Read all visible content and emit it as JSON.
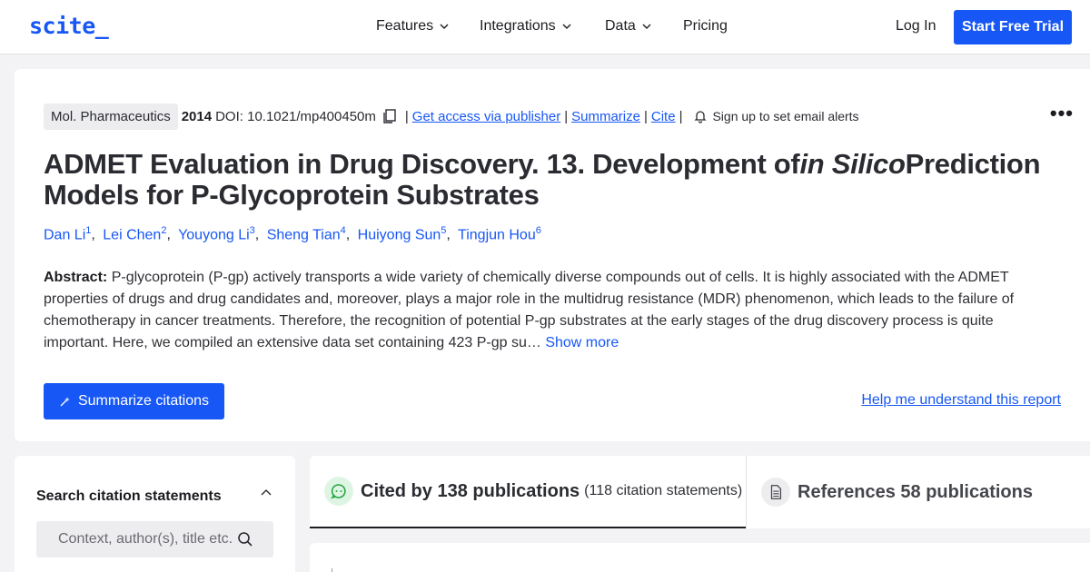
{
  "nav": {
    "logo": "scite_",
    "items": [
      "Features",
      "Integrations",
      "Data",
      "Pricing"
    ],
    "login": "Log In",
    "trial": "Start Free Trial"
  },
  "paper": {
    "journal": "Mol. Pharmaceutics",
    "year": "2014",
    "doi": "DOI: 10.1021/mp400450m",
    "links": {
      "access": "Get access via publisher",
      "summarize": "Summarize",
      "cite": "Cite"
    },
    "alert": "Sign up to set email alerts",
    "title_pre": "ADMET Evaluation in Drug Discovery. 13. Development of",
    "title_italic": "in Silico",
    "title_post": "Prediction Models for P-Glycoprotein Substrates",
    "authors": [
      {
        "name": "Dan Li",
        "sup": "1"
      },
      {
        "name": "Lei Chen",
        "sup": "2"
      },
      {
        "name": "Youyong Li",
        "sup": "3"
      },
      {
        "name": "Sheng Tian",
        "sup": "4"
      },
      {
        "name": "Huiyong Sun",
        "sup": "5"
      },
      {
        "name": "Tingjun Hou",
        "sup": "6"
      }
    ],
    "abstract_label": "Abstract:",
    "abstract_text": "P-glycoprotein (P-gp) actively transports a wide variety of chemically diverse compounds out of cells. It is highly associated with the ADMET properties of drugs and drug candidates and, moreover, plays a major role in the multidrug resistance (MDR) phenomenon, which leads to the failure of chemotherapy in cancer treatments. Therefore, the recognition of potential P-gp substrates at the early stages of the drug discovery process is quite important. Here, we compiled an extensive data set containing 423 P-gp su…",
    "show_more": "Show more",
    "summarize_citations": "Summarize citations",
    "help": "Help me understand this report"
  },
  "sidebar": {
    "title": "Search citation statements",
    "search_placeholder": "Context, author(s), title etc."
  },
  "tabs": {
    "cited_label": "Cited by 138 publications",
    "cited_sub": "(118 citation statements)",
    "refs_label": "References 58 publications"
  },
  "colors": {
    "accent": "#1757f5",
    "cited_icon_bg": "#dff5e3",
    "cited_icon": "#28a745"
  }
}
